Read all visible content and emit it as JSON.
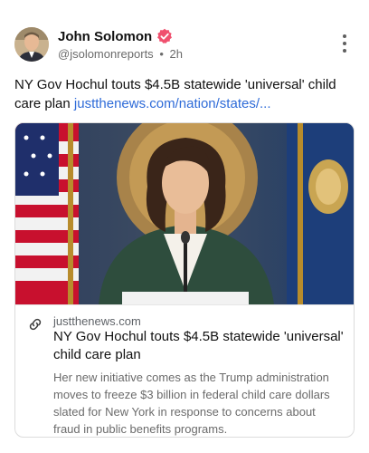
{
  "author": {
    "name": "John Solomon",
    "handle": "@jsolomonreports",
    "separator": "•",
    "time": "2h"
  },
  "post": {
    "text": "NY Gov Hochul touts $4.5B statewide 'universal' child care plan",
    "link_text": "justthenews.com/nation/states/..."
  },
  "card": {
    "domain": "justthenews.com",
    "title": "NY Gov Hochul touts $4.5B statewide 'universal' child care plan",
    "description": "Her new initiative comes as the Trump administration moves to freeze $3 billion in federal child care dollars slated for New York in response to concerns about fraud in public benefits programs."
  },
  "colors": {
    "link": "#2e6bd8",
    "verified_badge": "#f0506e",
    "muted_text": "#6b6b6b"
  },
  "icons": {
    "verified": "verified-badge-icon",
    "menu": "more-vertical-icon",
    "link": "link-icon"
  }
}
